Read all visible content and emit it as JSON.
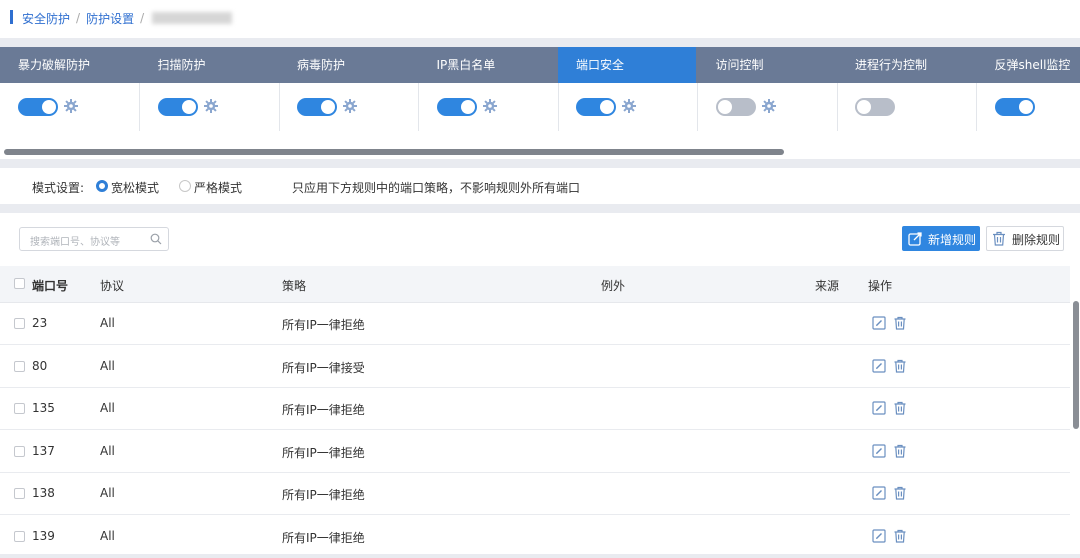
{
  "breadcrumb": {
    "item1": "安全防护",
    "sep": "/",
    "item2": "防护设置"
  },
  "tabs": [
    {
      "label": "暴力破解防护",
      "enabled": true,
      "has_settings": true
    },
    {
      "label": "扫描防护",
      "enabled": true,
      "has_settings": true
    },
    {
      "label": "病毒防护",
      "enabled": true,
      "has_settings": true
    },
    {
      "label": "IP黑白名单",
      "enabled": true,
      "has_settings": true
    },
    {
      "label": "端口安全",
      "enabled": true,
      "has_settings": true,
      "active": true
    },
    {
      "label": "访问控制",
      "enabled": false,
      "has_settings": true
    },
    {
      "label": "进程行为控制",
      "enabled": false,
      "has_settings": false
    },
    {
      "label": "反弹shell监控",
      "enabled": true,
      "has_settings": false
    }
  ],
  "mode": {
    "label": "模式设置:",
    "options": [
      {
        "label": "宽松模式",
        "selected": true
      },
      {
        "label": "严格模式",
        "selected": false
      }
    ],
    "description": "只应用下方规则中的端口策略，不影响规则外所有端口"
  },
  "search": {
    "placeholder": "搜索端口号、协议等"
  },
  "toolbar": {
    "add_label": "新增规则",
    "delete_label": "删除规则"
  },
  "table": {
    "headers": {
      "port": "端口号",
      "protocol": "协议",
      "policy": "策略",
      "exception": "例外",
      "source": "来源",
      "actions": "操作"
    },
    "rows": [
      {
        "port": "23",
        "protocol": "All",
        "policy": "所有IP一律拒绝"
      },
      {
        "port": "80",
        "protocol": "All",
        "policy": "所有IP一律接受"
      },
      {
        "port": "135",
        "protocol": "All",
        "policy": "所有IP一律拒绝"
      },
      {
        "port": "137",
        "protocol": "All",
        "policy": "所有IP一律拒绝"
      },
      {
        "port": "138",
        "protocol": "All",
        "policy": "所有IP一律拒绝"
      },
      {
        "port": "139",
        "protocol": "All",
        "policy": "所有IP一律拒绝"
      }
    ]
  },
  "colors": {
    "accent": "#2f7fd7",
    "tab_bar": "#6a7a96",
    "toggle_on": "#2f86e0",
    "toggle_off": "#b8bec9"
  }
}
